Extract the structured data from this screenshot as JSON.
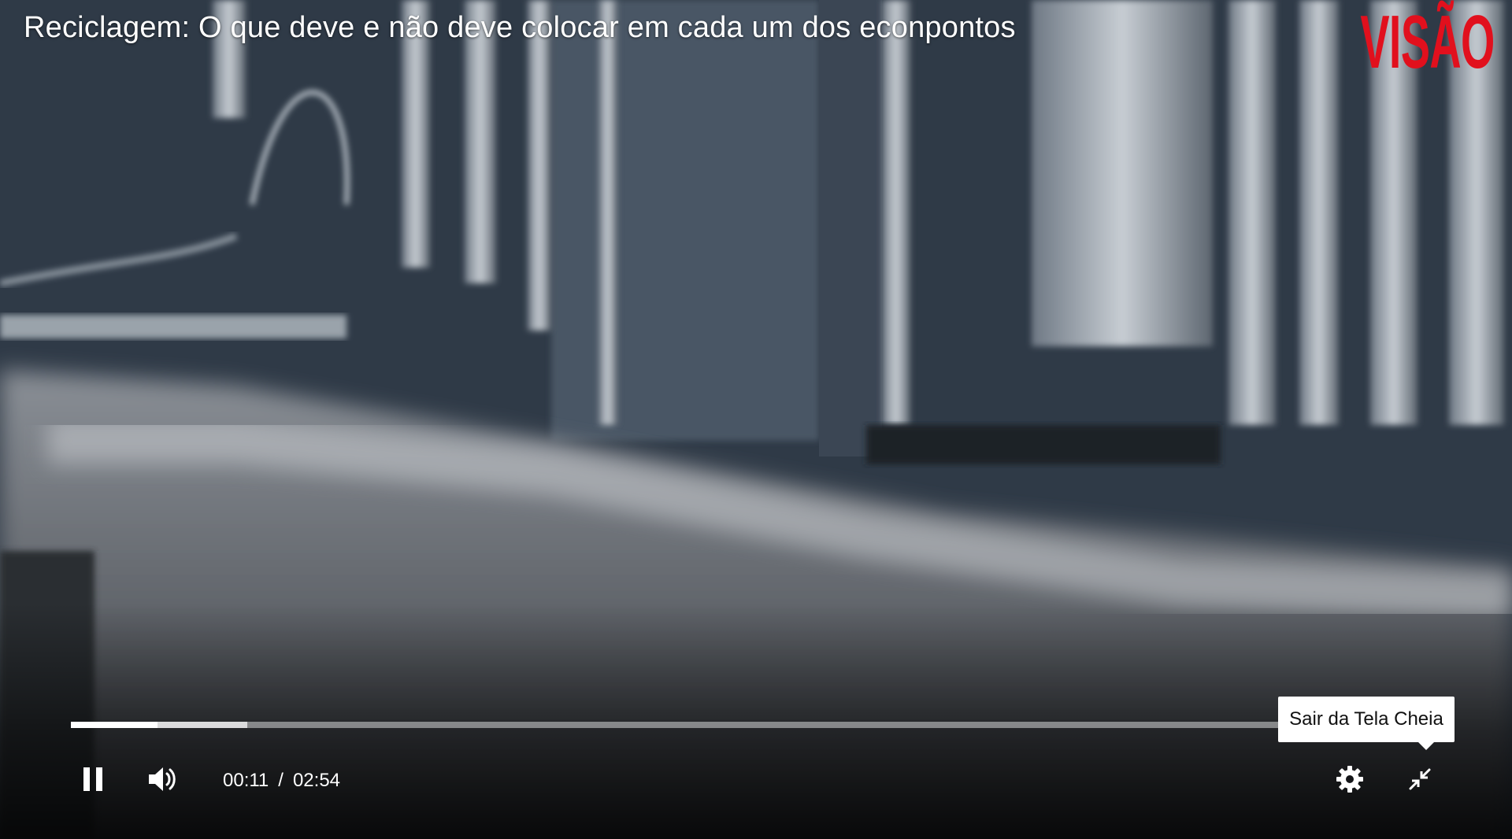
{
  "video": {
    "title": "Reciclagem: O que deve e não deve colocar em cada um dos econpontos",
    "brand_logo": "VISÃO",
    "brand_color": "#e1101d"
  },
  "controls": {
    "pause_icon": "pause-icon",
    "volume_icon": "volume-icon",
    "current_time": "00:11",
    "separator": "/",
    "duration": "02:54",
    "settings_icon": "gear-icon",
    "exit_fullscreen_icon": "exit-fullscreen-icon",
    "tooltip": "Sair da Tela Cheia",
    "played_fraction": 0.063,
    "buffered_fraction": 0.128
  }
}
